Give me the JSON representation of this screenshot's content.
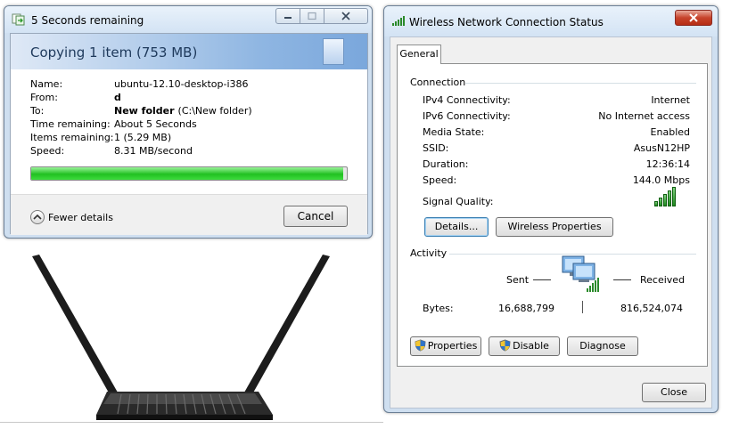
{
  "copy_dialog": {
    "title": "5 Seconds remaining",
    "header": "Copying 1 item (753 MB)",
    "details": [
      {
        "label": "Name:",
        "value": "ubuntu-12.10-desktop-i386",
        "bold": false,
        "extra": ""
      },
      {
        "label": "From:",
        "value": "d",
        "bold": true,
        "extra": ""
      },
      {
        "label": "To:",
        "value": "New folder",
        "bold": true,
        "extra": "(C:\\New folder)"
      },
      {
        "label": "Time remaining:",
        "value": "About 5 Seconds",
        "bold": false,
        "extra": ""
      },
      {
        "label": "Items remaining:",
        "value": "1 (5.29 MB)",
        "bold": false,
        "extra": ""
      },
      {
        "label": "Speed:",
        "value": "8.31 MB/second",
        "bold": false,
        "extra": ""
      }
    ],
    "progress_fraction": 0.99,
    "fewer_details_label": "Fewer details",
    "cancel_label": "Cancel"
  },
  "status_dialog": {
    "title": "Wireless Network Connection Status",
    "tab_label": "General",
    "connection_label": "Connection",
    "connection_rows": [
      {
        "key": "IPv4 Connectivity:",
        "value": "Internet"
      },
      {
        "key": "IPv6 Connectivity:",
        "value": "No Internet access"
      },
      {
        "key": "Media State:",
        "value": "Enabled"
      },
      {
        "key": "SSID:",
        "value": "AsusN12HP"
      },
      {
        "key": "Duration:",
        "value": "12:36:14"
      },
      {
        "key": "Speed:",
        "value": "144.0 Mbps"
      }
    ],
    "signal_quality_label": "Signal Quality:",
    "signal_bars": 5,
    "details_button": "Details...",
    "wireless_properties_button": "Wireless Properties",
    "activity_label": "Activity",
    "sent_label": "Sent",
    "received_label": "Received",
    "bytes_label": "Bytes:",
    "bytes_sent": "16,688,799",
    "bytes_received": "816,524,074",
    "properties_button": "Properties",
    "disable_button": "Disable",
    "diagnose_button": "Diagnose",
    "close_button": "Close"
  },
  "colors": {
    "progress_green": "#21c021",
    "signal_green": "#1e8a1e",
    "close_red": "#c7432b"
  }
}
